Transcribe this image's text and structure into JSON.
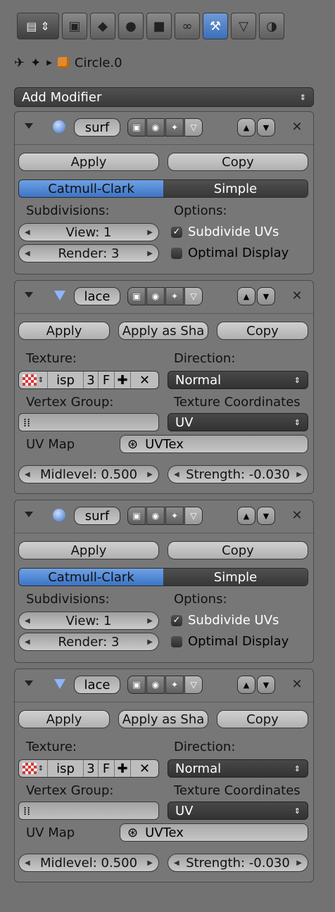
{
  "tabs": [
    {
      "name": "context-selector",
      "glyph": "▤"
    },
    {
      "name": "render",
      "glyph": "▣"
    },
    {
      "name": "scene",
      "glyph": "◆"
    },
    {
      "name": "world",
      "glyph": "●"
    },
    {
      "name": "object",
      "glyph": "■"
    },
    {
      "name": "constraints",
      "glyph": "∞"
    },
    {
      "name": "modifiers",
      "glyph": "⚒"
    },
    {
      "name": "data",
      "glyph": "▽"
    },
    {
      "name": "material",
      "glyph": "◑"
    }
  ],
  "breadcrumb": {
    "object": "Circle.0"
  },
  "add_modifier": "Add Modifier",
  "modifiers": [
    {
      "kind": "subsurf",
      "name": "surf",
      "apply": "Apply",
      "copy": "Copy",
      "mode_a": "Catmull-Clark",
      "mode_b": "Simple",
      "subdivisions_label": "Subdivisions:",
      "options_label": "Options:",
      "view": "View: 1",
      "render": "Render: 3",
      "opt1": "Subdivide UVs",
      "opt1_checked": true,
      "opt2": "Optimal Display",
      "opt2_checked": false
    },
    {
      "kind": "displace",
      "name": "lace",
      "apply": "Apply",
      "apply_shape": "Apply as Sha",
      "copy": "Copy",
      "texture_label": "Texture:",
      "direction_label": "Direction:",
      "tex_name": "isp",
      "tex_users": "3",
      "tex_fake": "F",
      "direction": "Normal",
      "vgroup_label": "Vertex Group:",
      "texcoords_label": "Texture Coordinates",
      "texcoords": "UV",
      "uvmap_label": "UV Map",
      "uvmap": "UVTex",
      "midlevel": "Midlevel: 0.500",
      "strength": "Strength: -0.030"
    },
    {
      "kind": "subsurf",
      "name": "surf",
      "apply": "Apply",
      "copy": "Copy",
      "mode_a": "Catmull-Clark",
      "mode_b": "Simple",
      "subdivisions_label": "Subdivisions:",
      "options_label": "Options:",
      "view": "View: 1",
      "render": "Render: 3",
      "opt1": "Subdivide UVs",
      "opt1_checked": true,
      "opt2": "Optimal Display",
      "opt2_checked": false
    },
    {
      "kind": "displace",
      "name": "lace",
      "apply": "Apply",
      "apply_shape": "Apply as Sha",
      "copy": "Copy",
      "texture_label": "Texture:",
      "direction_label": "Direction:",
      "tex_name": "isp",
      "tex_users": "3",
      "tex_fake": "F",
      "direction": "Normal",
      "vgroup_label": "Vertex Group:",
      "texcoords_label": "Texture Coordinates",
      "texcoords": "UV",
      "uvmap_label": "UV Map",
      "uvmap": "UVTex",
      "midlevel": "Midlevel: 0.500",
      "strength": "Strength: -0.030"
    }
  ]
}
